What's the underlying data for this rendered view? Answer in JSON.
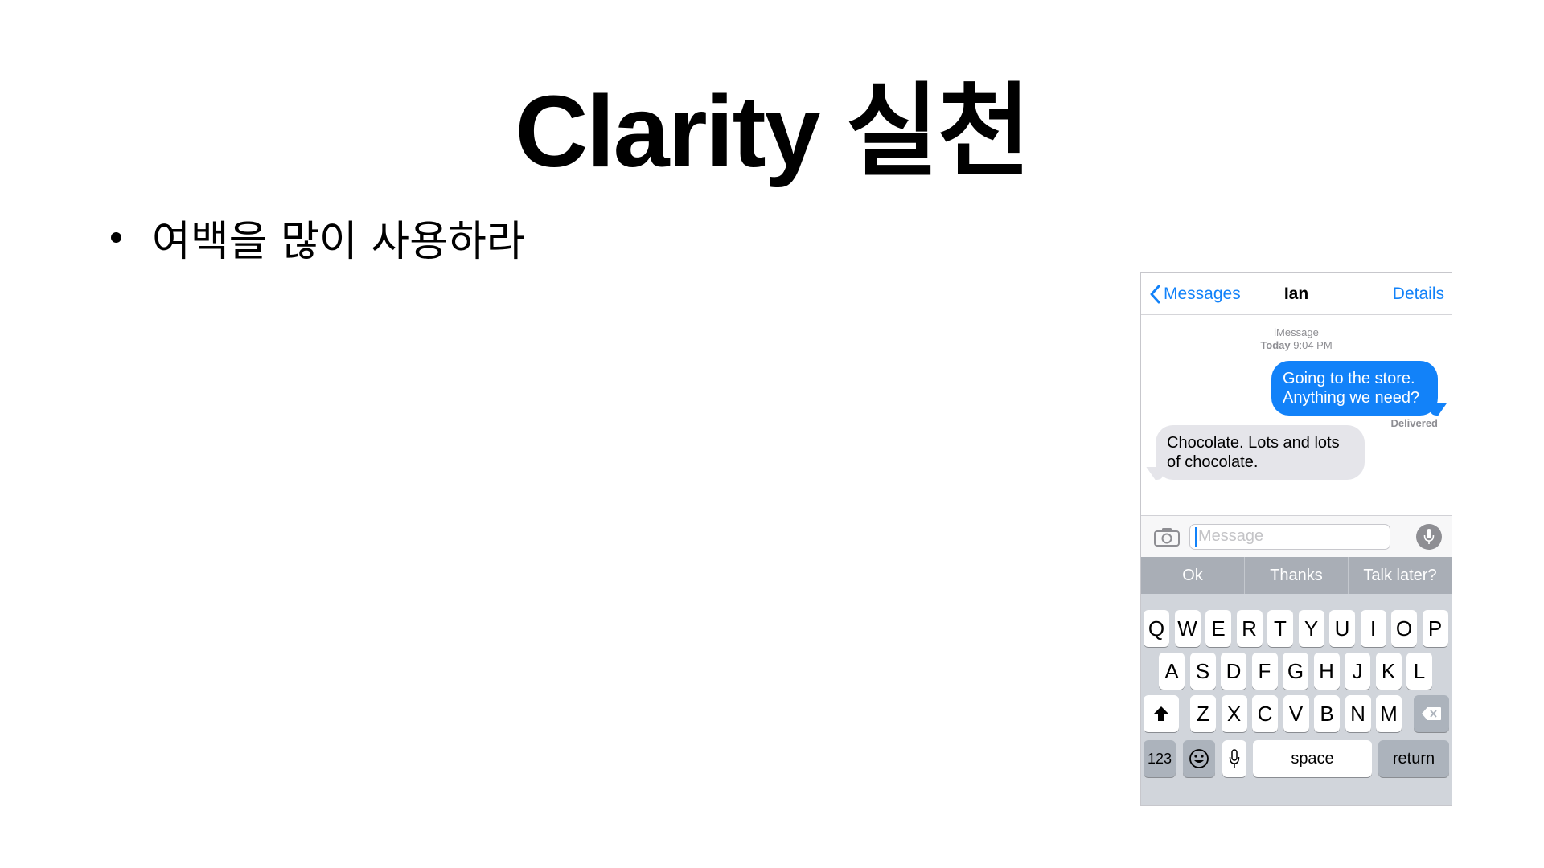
{
  "slide": {
    "title": "Clarity 실천",
    "bullet": "여백을 많이 사용하라"
  },
  "phone": {
    "nav": {
      "back_label": "Messages",
      "title": "Ian",
      "details_label": "Details"
    },
    "conversation": {
      "service": "iMessage",
      "day": "Today",
      "time": "9:04 PM",
      "outgoing_text": "Going to the store. Anything we need?",
      "status": "Delivered",
      "incoming_text": "Chocolate. Lots and lots of chocolate."
    },
    "input": {
      "placeholder": "Message"
    },
    "suggestions": [
      "Ok",
      "Thanks",
      "Talk later?"
    ],
    "keyboard": {
      "row1": [
        "Q",
        "W",
        "E",
        "R",
        "T",
        "Y",
        "U",
        "I",
        "O",
        "P"
      ],
      "row2": [
        "A",
        "S",
        "D",
        "F",
        "G",
        "H",
        "J",
        "K",
        "L"
      ],
      "row3": [
        "Z",
        "X",
        "C",
        "V",
        "B",
        "N",
        "M"
      ],
      "numbers_label": "123",
      "space_label": "space",
      "return_label": "return"
    },
    "colors": {
      "accent": "#1282f9",
      "incoming_bubble": "#e5e5ea",
      "keyboard_bg": "#d1d5db",
      "suggestion_bar": "#a9aeb6"
    }
  }
}
